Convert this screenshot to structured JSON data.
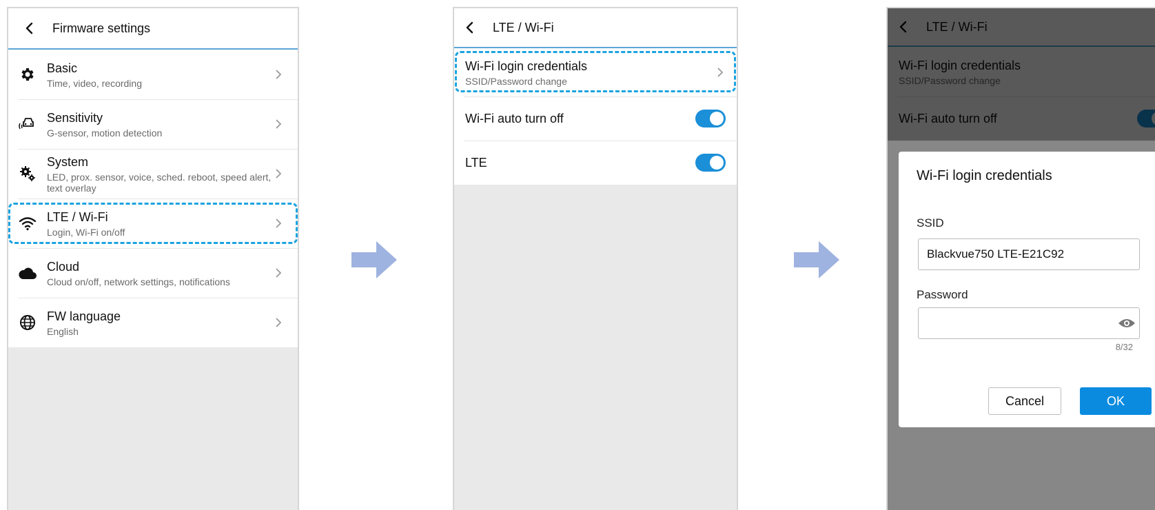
{
  "colors": {
    "accent": "#1b8fd8",
    "highlight": "#1ba3e0",
    "arrow": "#9fb3e0"
  },
  "screen1": {
    "title": "Firmware settings",
    "items": [
      {
        "icon": "gear-icon",
        "label": "Basic",
        "sub": "Time, video, recording"
      },
      {
        "icon": "car-sensor-icon",
        "label": "Sensitivity",
        "sub": "G-sensor, motion detection"
      },
      {
        "icon": "gears-icon",
        "label": "System",
        "sub": "LED, prox. sensor, voice, sched. reboot, speed alert,",
        "sub2": "text overlay"
      },
      {
        "icon": "wifi-icon",
        "label": "LTE / Wi-Fi",
        "sub": "Login, Wi-Fi on/off"
      },
      {
        "icon": "cloud-icon",
        "label": "Cloud",
        "sub": "Cloud on/off, network settings, notifications"
      },
      {
        "icon": "globe-icon",
        "label": "FW language",
        "sub": "English"
      }
    ]
  },
  "screen2": {
    "title": "LTE / Wi-Fi",
    "items": [
      {
        "label": "Wi-Fi login credentials",
        "sub": "SSID/Password change"
      },
      {
        "label": "Wi-Fi auto turn off",
        "toggle": true
      },
      {
        "label": "LTE",
        "toggle": true
      }
    ]
  },
  "screen3": {
    "title": "LTE / Wi-Fi",
    "items": [
      {
        "label": "Wi-Fi login credentials",
        "sub": "SSID/Password change"
      },
      {
        "label": "Wi-Fi auto turn off",
        "toggle": true
      }
    ],
    "dialog": {
      "title": "Wi-Fi login credentials",
      "ssid_label": "SSID",
      "ssid_value": "Blackvue750 LTE-E21C92",
      "password_label": "Password",
      "password_value": "",
      "counter": "8/32",
      "cancel": "Cancel",
      "ok": "OK"
    }
  }
}
